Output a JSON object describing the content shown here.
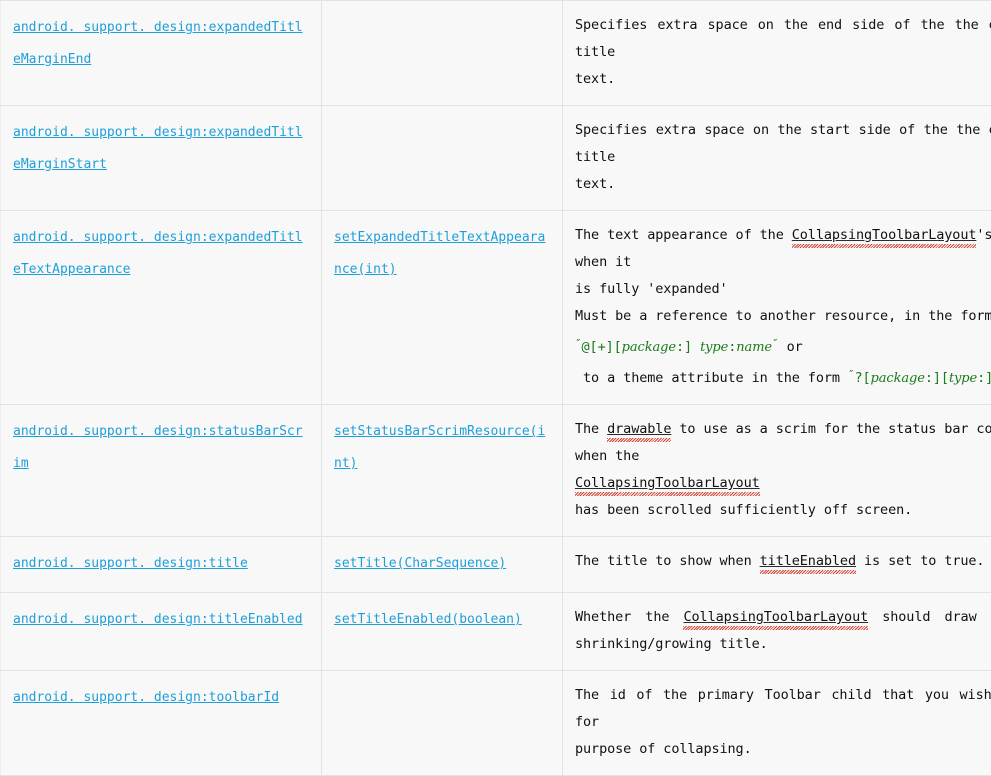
{
  "table": {
    "columns": [
      "attribute",
      "method",
      "description"
    ],
    "rows": [
      {
        "attribute": "android. support. design:expandedTitleMarginEnd",
        "method": "",
        "description_lines": [
          "Specifies extra space on the end side of the the expanded title",
          "text."
        ],
        "description_plain": "Specifies extra space on the end side of the the expanded title text."
      },
      {
        "attribute": "android. support. design:expandedTitleMarginStart",
        "method": "",
        "description_lines": [
          "Specifies extra space on the start side of the the expanded title",
          "text."
        ],
        "description_plain": "Specifies extra space on the start side of the the expanded title text."
      },
      {
        "attribute": "android. support. design:expandedTitleTextAppearance",
        "method": "setExpandedTitleTextAppearance(int)",
        "description_lines": [
          "The text appearance of the CollapsingToolbarLayout's title when it",
          "is fully 'expanded'",
          "Must be a reference to another resource, in the form",
          "\"@[+][package:] type:name\" or",
          " to a theme attribute in the form \"?[package:][type:]name\"."
        ],
        "description_plain": "The text appearance of the CollapsingToolbarLayout's title when it is fully 'expanded' Must be a reference to another resource, in the form \"@[+][package:] type:name\" or to a theme attribute in the form \"?[package:][type:]name\".",
        "tokens": {
          "class_ref": "CollapsingToolbarLayout",
          "quoted_1": "@[+][package:] type:name",
          "quoted_2": "?[package:][type:]name",
          "apostrophe_s": "'s",
          "expanded_quoted": "'expanded'"
        }
      },
      {
        "attribute": "android. support. design:statusBarScrim",
        "method": "setStatusBarScrimResource(int)",
        "description_lines": [
          "The drawable to use as a scrim for the status bar content when the",
          "CollapsingToolbarLayout",
          "has been scrolled sufficiently off screen."
        ],
        "description_plain": "The drawable to use as a scrim for the status bar content when the CollapsingToolbarLayout has been scrolled sufficiently off screen.",
        "tokens": {
          "word_1": "drawable",
          "class_ref": "CollapsingToolbarLayout"
        }
      },
      {
        "attribute": "android. support. design:title",
        "method": "setTitle(CharSequence)",
        "description_lines": [
          "The title to show when titleEnabled is set to true."
        ],
        "description_plain": "The title to show when titleEnabled is set to true.",
        "tokens": {
          "word_1": "titleEnabled"
        }
      },
      {
        "attribute": "android. support. design:titleEnabled",
        "method": "setTitleEnabled(boolean)",
        "description_lines": [
          "Whether  the  CollapsingToolbarLayout  should  draw  its  own",
          "shrinking/growing title."
        ],
        "description_plain": "Whether the CollapsingToolbarLayout should draw its own shrinking/growing title.",
        "tokens": {
          "class_ref": "CollapsingToolbarLayout"
        }
      },
      {
        "attribute": "android. support. design:toolbarId",
        "method": "",
        "description_lines": [
          "The id of the primary Toolbar child that you wish to use for the",
          "purpose of collapsing."
        ],
        "description_plain": "The id of the primary Toolbar child that you wish to use for the purpose of collapsing."
      }
    ]
  },
  "colors": {
    "link": "#1e9fd8",
    "text": "#111111",
    "code_green": "#1a7a1a",
    "spellcheck": "#d33a2c",
    "cell_bg": "#f8f8f8",
    "border": "#e3e3e3"
  }
}
